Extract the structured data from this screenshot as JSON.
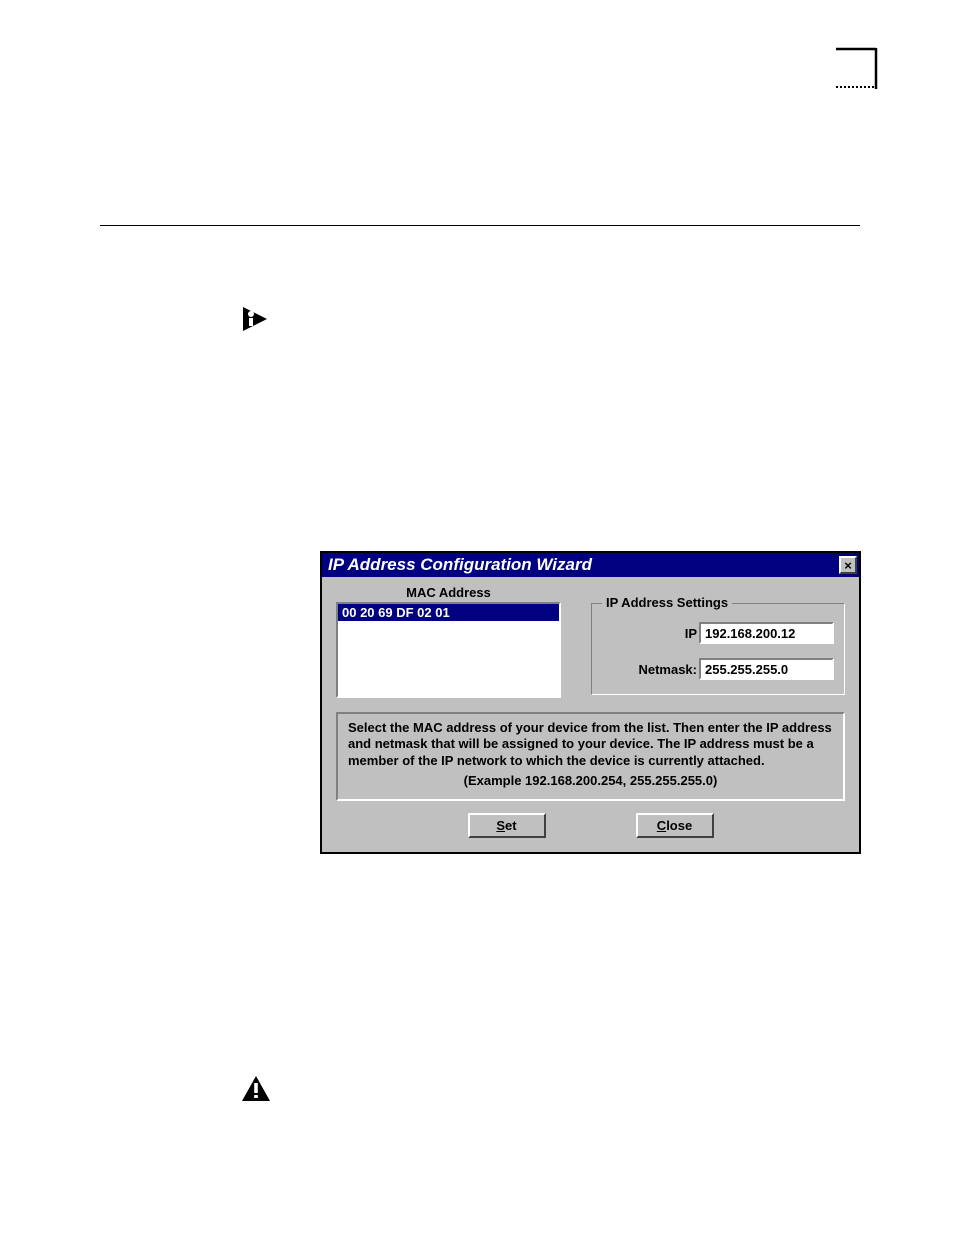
{
  "dialog": {
    "title": "IP Address Configuration Wizard",
    "close_symbol": "×",
    "mac_heading": "MAC Address",
    "mac_items": [
      "00 20 69 DF 02 01"
    ],
    "ip_settings_legend": "IP Address Settings",
    "ip_label": "IP",
    "ip_value": "192.168.200.12",
    "netmask_label": "Netmask:",
    "netmask_value": "255.255.255.0",
    "help_text": "Select the MAC address of your device from the list. Then enter the IP address and netmask that will be assigned to your device. The IP address must be a member of the IP network to which the device is currently attached.",
    "help_example": "(Example 192.168.200.254, 255.255.255.0)",
    "set_label": "Set",
    "close_label": "Close"
  }
}
